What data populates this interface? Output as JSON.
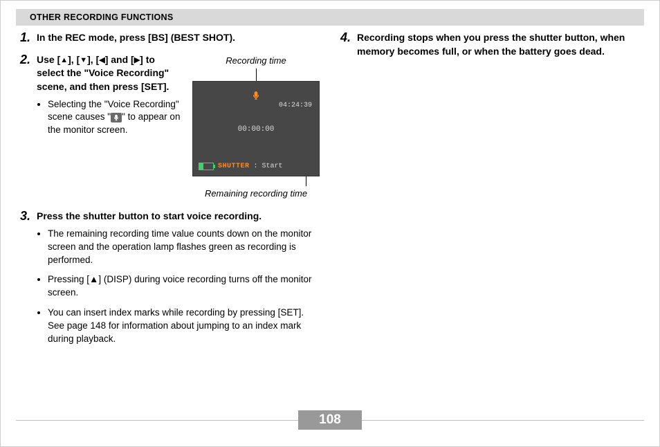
{
  "header": {
    "section_title": "OTHER RECORDING FUNCTIONS"
  },
  "steps": [
    {
      "num": "1.",
      "title": "In the REC mode, press [BS] (BEST SHOT)."
    },
    {
      "num": "2.",
      "title_prefix": "Use [",
      "title_mid1": "], [",
      "title_mid2": "], [",
      "title_mid3": "] and [",
      "title_suffix": "] to select the \"Voice Recording\" scene, and then press [SET].",
      "bullet_prefix": "Selecting the \"Voice Recording\" scene causes \"",
      "bullet_suffix": "\" to appear on the monitor screen."
    },
    {
      "num": "3.",
      "title": "Press the shutter button to start voice recording.",
      "bullets": [
        "The remaining recording time value counts down on the monitor screen and the operation lamp flashes green as recording is performed.",
        "Pressing [▲] (DISP) during voice recording turns off the monitor screen.",
        "You can insert index marks while recording by pressing [SET]. See page 148 for information about jumping to an index mark during playback."
      ]
    },
    {
      "num": "4.",
      "title": "Recording stops when you press the shutter button, when memory becomes full, or when the battery goes dead."
    }
  ],
  "callouts": {
    "top": "Recording time",
    "bottom": "Remaining recording time"
  },
  "lcd": {
    "remaining_time": "04:24:39",
    "elapsed_time": "00:00:00",
    "shutter_label": "SHUTTER",
    "start_label": ": Start"
  },
  "glyphs": {
    "up": "▲",
    "down": "▼",
    "left": "◀",
    "right": "▶",
    "mic": "🎤"
  },
  "footer": {
    "page_number": "108"
  }
}
